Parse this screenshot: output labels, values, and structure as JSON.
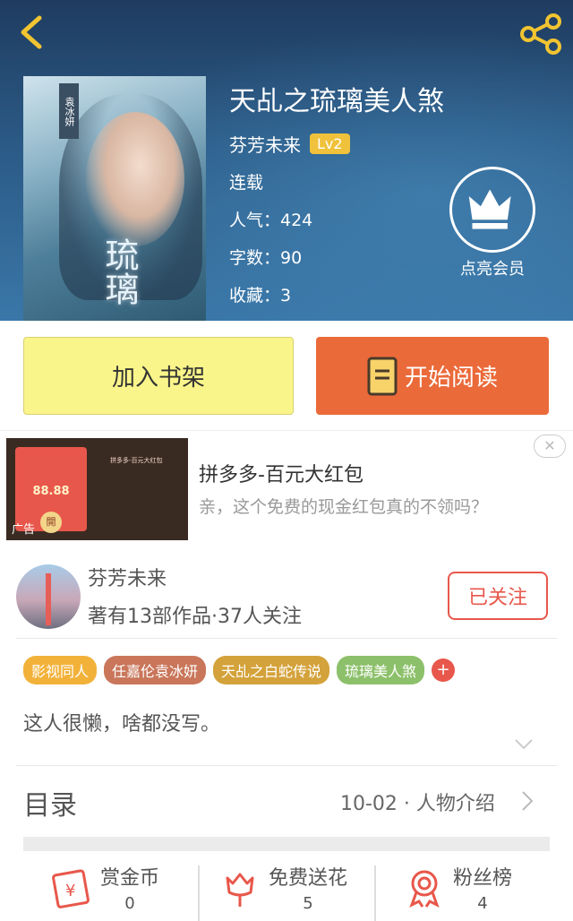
{
  "header": {
    "book_title": "天乩之琉璃美人煞",
    "author": "芬芳未来",
    "level": "Lv2",
    "status": "连载",
    "popularity": "人气：424",
    "word_count": "字数：90",
    "favorites": "收藏：3",
    "vip_label": "点亮会员",
    "cover_title": "琉璃",
    "cover_tag": "袁冰妍"
  },
  "actions": {
    "add_shelf": "加入书架",
    "start_read": "开始阅读"
  },
  "ad": {
    "title": "拼多多-百元大红包",
    "desc": "亲，这个免费的现金红包真的不领吗？",
    "amount": "88.88",
    "open": "開",
    "ad_mark": "广告",
    "close": "✕",
    "mini_title": "拼多多-百元大红包"
  },
  "author_card": {
    "name": "芬芳未来",
    "stats": "著有13部作品·37人关注",
    "follow": "已关注",
    "tags": [
      {
        "label": "影视同人",
        "color": "#f2b23a"
      },
      {
        "label": "任嘉伦袁冰妍",
        "color": "#c9765a"
      },
      {
        "label": "天乩之白蛇传说",
        "color": "#d4a23a"
      },
      {
        "label": "琉璃美人煞",
        "color": "#8cc06a"
      }
    ],
    "tag_plus": "+",
    "bio": "这人很懒，啥都没写。"
  },
  "toc": {
    "title": "目录",
    "latest": "10-02 · 人物介绍"
  },
  "bottom": {
    "reward_label": "赏金币",
    "reward_value": "0",
    "flower_label": "免费送花",
    "flower_value": "5",
    "fans_label": "粉丝榜",
    "fans_value": "4"
  },
  "colors": {
    "accent": "#e8574b",
    "read_button": "#eb6a3a",
    "shelf_button": "#faf58a",
    "level_badge": "#f0c23b"
  }
}
